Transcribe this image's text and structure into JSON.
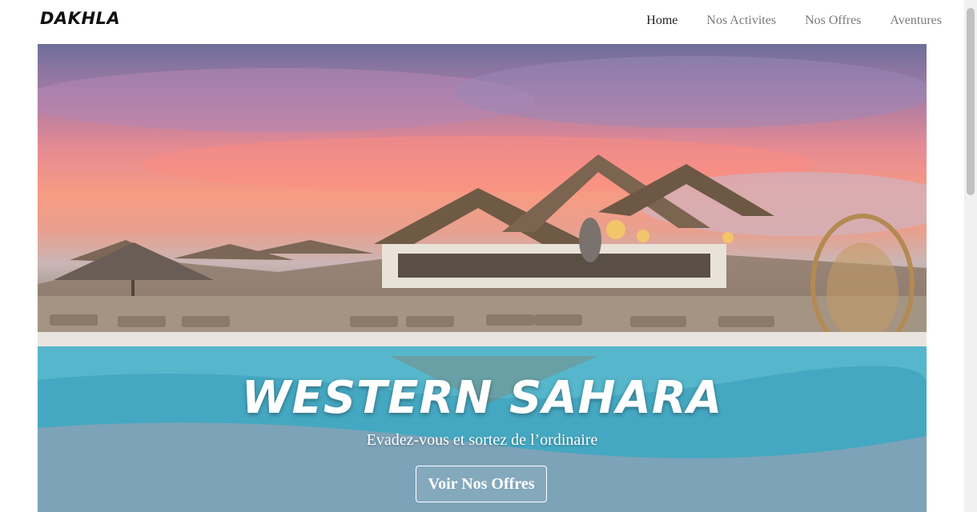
{
  "navbar": {
    "logo": "DAKHLA",
    "links": [
      {
        "label": "Home",
        "active": true
      },
      {
        "label": "Nos Activites",
        "active": false
      },
      {
        "label": "Nos Offres",
        "active": false
      },
      {
        "label": "Aventures",
        "active": false
      }
    ]
  },
  "hero": {
    "title": "WESTERN SAHARA",
    "subtitle": "Evadez-vous et sortez de l’ordinaire",
    "cta_label": "Voir Nos Offres"
  },
  "colors": {
    "nav_active": "#222222",
    "nav_inactive": "#7a7a7a",
    "hero_text": "#ffffff"
  }
}
